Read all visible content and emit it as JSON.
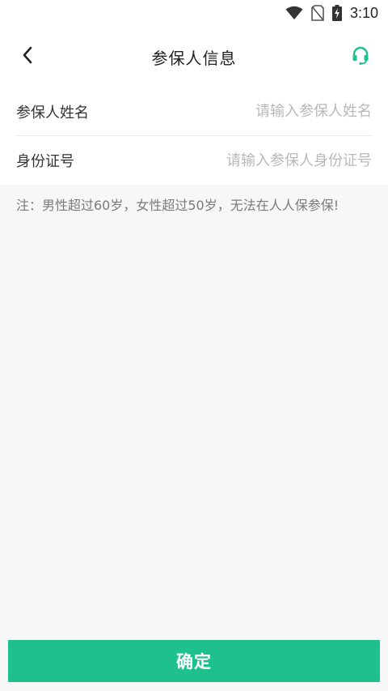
{
  "status_bar": {
    "time": "3:10",
    "icons": [
      "wifi-icon",
      "no-sim-icon",
      "battery-charging-icon"
    ]
  },
  "header": {
    "title": "参保人信息",
    "back_icon": "chevron-left-icon",
    "service_icon": "headset-icon"
  },
  "form": {
    "name_label": "参保人姓名",
    "name_placeholder": "请输入参保人姓名",
    "name_value": "",
    "id_label": "身份证号",
    "id_placeholder": "请输入参保人身份证号",
    "id_value": ""
  },
  "note": "注：男性超过60岁，女性超过50岁，无法在人人保参保!",
  "confirm_label": "确定",
  "colors": {
    "accent": "#1ec08e",
    "background": "#f7f7f7",
    "placeholder": "#b8b8b8"
  }
}
